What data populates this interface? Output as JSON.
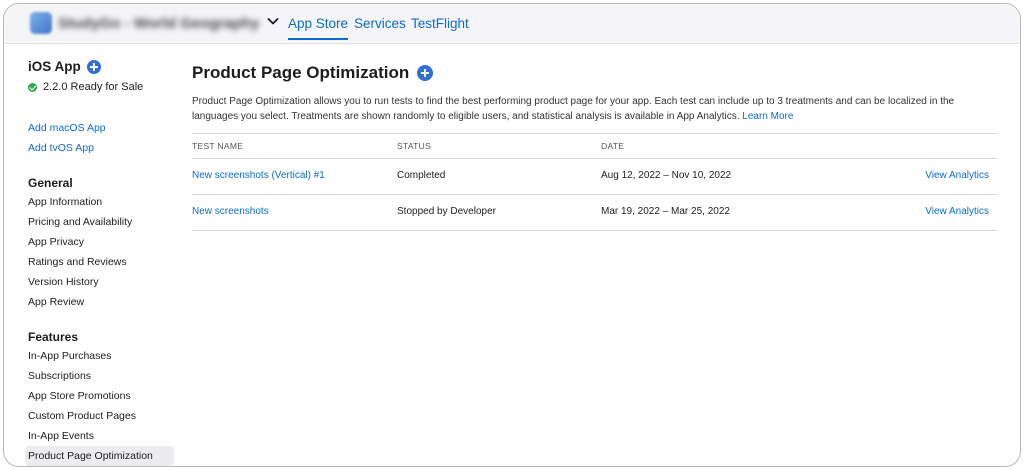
{
  "topnav": {
    "app_name": "StudyGo - World Geography",
    "tabs": [
      {
        "label": "App Store",
        "active": true
      },
      {
        "label": "Services",
        "active": false
      },
      {
        "label": "TestFlight",
        "active": false
      }
    ],
    "accent_color": "#0a6ccf"
  },
  "sidebar": {
    "platform_title": "iOS App",
    "version_status": "2.2.0 Ready for Sale",
    "add_links": [
      "Add macOS App",
      "Add tvOS App"
    ],
    "general": {
      "heading": "General",
      "items": [
        "App Information",
        "Pricing and Availability",
        "App Privacy",
        "Ratings and Reviews",
        "Version History",
        "App Review"
      ]
    },
    "features": {
      "heading": "Features",
      "items": [
        "In-App Purchases",
        "Subscriptions",
        "App Store Promotions",
        "Custom Product Pages",
        "In-App Events",
        "Product Page Optimization"
      ],
      "selected": "Product Page Optimization"
    }
  },
  "main": {
    "title": "Product Page Optimization",
    "description": "Product Page Optimization allows you to run tests to find the best performing product page for your app. Each test can include up to 3 treatments and can be localized in the languages you select. Treatments are shown randomly to eligible users, and statistical analysis is available in App Analytics.",
    "learn_more": "Learn More",
    "table": {
      "headers": [
        "TEST NAME",
        "STATUS",
        "DATE"
      ],
      "rows": [
        {
          "name": "New screenshots (Vertical) #1",
          "status": "Completed",
          "date": "Aug 12, 2022 – Nov 10, 2022",
          "action": "View Analytics"
        },
        {
          "name": "New screenshots",
          "status": "Stopped by Developer",
          "date": "Mar 19, 2022 – Mar 25, 2022",
          "action": "View Analytics"
        }
      ]
    }
  }
}
